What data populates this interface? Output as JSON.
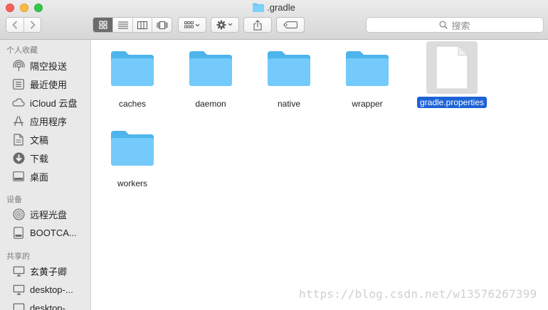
{
  "window": {
    "title": ".gradle"
  },
  "toolbar": {
    "view_modes": [
      "icon-view",
      "list-view",
      "column-view",
      "cover-flow-view"
    ],
    "active_view": 0,
    "search_placeholder": "搜索"
  },
  "sidebar": {
    "sections": [
      {
        "title": "个人收藏",
        "items": [
          {
            "label": "隔空投送",
            "icon": "airdrop-icon"
          },
          {
            "label": "最近使用",
            "icon": "recents-icon"
          },
          {
            "label": "iCloud 云盘",
            "icon": "cloud-icon"
          },
          {
            "label": "应用程序",
            "icon": "applications-icon"
          },
          {
            "label": "文稿",
            "icon": "document-icon"
          },
          {
            "label": "下载",
            "icon": "download-icon"
          },
          {
            "label": "桌面",
            "icon": "desktop-icon"
          }
        ]
      },
      {
        "title": "设备",
        "items": [
          {
            "label": "远程光盘",
            "icon": "disc-icon"
          },
          {
            "label": "BOOTCA...",
            "icon": "drive-icon"
          }
        ]
      },
      {
        "title": "共享的",
        "items": [
          {
            "label": "玄黄子卿",
            "icon": "computer-icon"
          },
          {
            "label": "desktop-...",
            "icon": "computer-icon"
          },
          {
            "label": "desktop-...",
            "icon": "computer-icon"
          }
        ]
      }
    ]
  },
  "files": [
    {
      "name": "caches",
      "type": "folder"
    },
    {
      "name": "daemon",
      "type": "folder"
    },
    {
      "name": "native",
      "type": "folder"
    },
    {
      "name": "wrapper",
      "type": "folder"
    },
    {
      "name": "gradle.properties",
      "type": "file",
      "selected": true
    },
    {
      "name": "workers",
      "type": "folder"
    }
  ],
  "watermark": "https://blog.csdn.net/w13576267399",
  "colors": {
    "folder": "#5cc1f7",
    "selection": "#1c63d6",
    "sidebar_bg": "#e9e9ea"
  }
}
